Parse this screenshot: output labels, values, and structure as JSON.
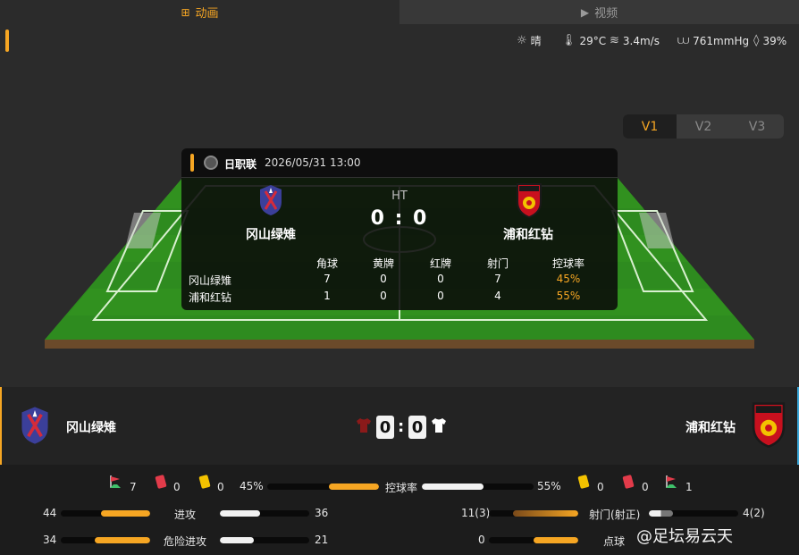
{
  "tabs": [
    {
      "label": "动画",
      "icon": "pitch-icon",
      "active": true
    },
    {
      "label": "视频",
      "icon": "video-icon",
      "active": false
    }
  ],
  "weather": {
    "condition": "晴",
    "temperature": "29°C",
    "wind": "3.4m/s",
    "pressure": "761mmHg",
    "humidity": "39%"
  },
  "view_selector": [
    "V1",
    "V2",
    "V3"
  ],
  "match": {
    "league": "日职联",
    "datetime": "2026/05/31 13:00",
    "status": "HT",
    "score": "0 : 0",
    "home": {
      "name": "冈山绿雉",
      "score": "0"
    },
    "away": {
      "name": "浦和红钻",
      "score": "0"
    }
  },
  "stats_table": {
    "headers": [
      "角球",
      "黄牌",
      "红牌",
      "射门",
      "控球率"
    ],
    "rows": [
      {
        "team": "冈山绿雉",
        "values": [
          "7",
          "0",
          "0",
          "7",
          "45%"
        ]
      },
      {
        "team": "浦和红钻",
        "values": [
          "1",
          "0",
          "0",
          "4",
          "55%"
        ]
      }
    ]
  },
  "summary": {
    "home_corners": "7",
    "home_red": "0",
    "home_yellow": "0",
    "home_possession": "45%",
    "possession_label": "控球率",
    "away_possession": "55%",
    "away_yellow": "0",
    "away_red": "0",
    "away_corners": "1"
  },
  "bars_left": [
    {
      "label": "进攻",
      "home": "44",
      "away": "36",
      "home_frac": 0.55,
      "away_frac": 0.45
    },
    {
      "label": "危险进攻",
      "home": "34",
      "away": "21",
      "home_frac": 0.62,
      "away_frac": 0.38
    }
  ],
  "bars_right": [
    {
      "label": "射门(射正)",
      "home": "11(3)",
      "away": "4(2)",
      "home_frac": 0.73,
      "away_frac": 0.27
    },
    {
      "label": "点球",
      "home": "0",
      "away": "",
      "home_frac": 0.5,
      "away_frac": 0.0
    }
  ],
  "watermark": "@足坛易云天",
  "colors": {
    "accent": "#f6a623",
    "pitch": "#2e8b1f",
    "home_shirt": "#8b1a1a",
    "away_shirt": "#ffffff"
  }
}
